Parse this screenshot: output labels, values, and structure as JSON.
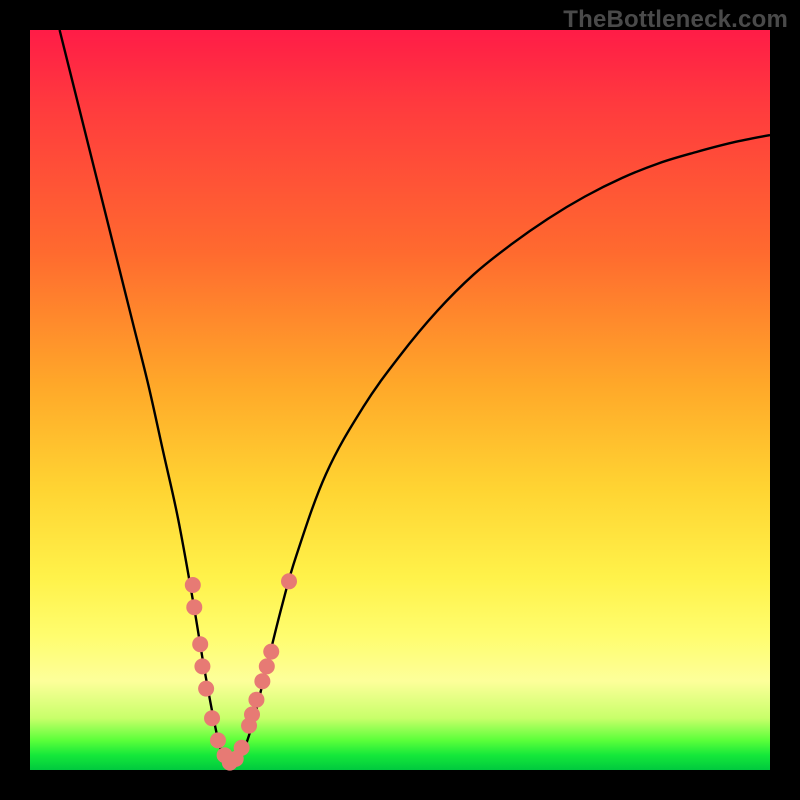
{
  "watermark": "TheBottleneck.com",
  "colors": {
    "frame": "#000000",
    "gradient_top": "#ff1c47",
    "gradient_bottom": "#00c93e",
    "curve": "#000000",
    "dots": "#e77a74"
  },
  "chart_data": {
    "type": "line",
    "title": "",
    "xlabel": "",
    "ylabel": "",
    "xlim": [
      0,
      100
    ],
    "ylim": [
      0,
      100
    ],
    "x": [
      4,
      6,
      8,
      10,
      12,
      14,
      16,
      18,
      20,
      22,
      23.5,
      25,
      26,
      27,
      28.5,
      30,
      32,
      34,
      36,
      40,
      45,
      50,
      55,
      60,
      65,
      70,
      75,
      80,
      85,
      90,
      95,
      100
    ],
    "y": [
      100,
      92,
      84,
      76,
      68,
      60,
      52,
      43,
      34,
      23,
      14,
      6,
      2,
      0.5,
      2,
      6,
      14,
      22,
      29,
      40,
      49,
      56,
      62,
      67,
      71,
      74.5,
      77.5,
      80,
      82,
      83.5,
      84.8,
      85.8
    ],
    "annotations_dots": [
      {
        "x": 22.0,
        "y": 25
      },
      {
        "x": 22.2,
        "y": 22
      },
      {
        "x": 23.0,
        "y": 17
      },
      {
        "x": 23.3,
        "y": 14
      },
      {
        "x": 23.8,
        "y": 11
      },
      {
        "x": 24.6,
        "y": 7
      },
      {
        "x": 25.4,
        "y": 4
      },
      {
        "x": 26.3,
        "y": 2
      },
      {
        "x": 27.0,
        "y": 1.0
      },
      {
        "x": 27.8,
        "y": 1.5
      },
      {
        "x": 28.6,
        "y": 3
      },
      {
        "x": 29.6,
        "y": 6
      },
      {
        "x": 30.0,
        "y": 7.5
      },
      {
        "x": 30.6,
        "y": 9.5
      },
      {
        "x": 31.4,
        "y": 12
      },
      {
        "x": 32.0,
        "y": 14
      },
      {
        "x": 32.6,
        "y": 16
      },
      {
        "x": 35.0,
        "y": 25.5
      }
    ]
  }
}
